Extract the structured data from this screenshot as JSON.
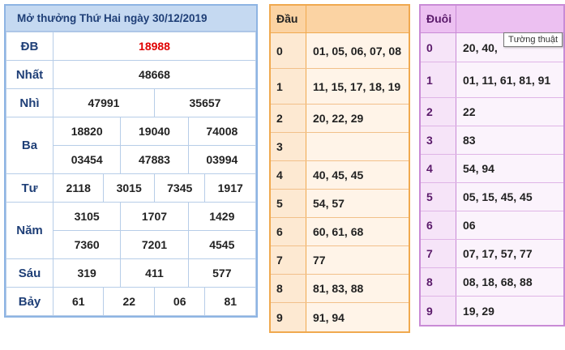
{
  "results": {
    "title": "Mở thưởng Thứ Hai ngày 30/12/2019",
    "db": {
      "label": "ĐB",
      "value": "18988"
    },
    "nhat": {
      "label": "Nhất",
      "value": "48668"
    },
    "nhi": {
      "label": "Nhì",
      "values": [
        "47991",
        "35657"
      ]
    },
    "ba": {
      "label": "Ba",
      "values": [
        "18820",
        "19040",
        "74008",
        "03454",
        "47883",
        "03994"
      ]
    },
    "tu": {
      "label": "Tư",
      "values": [
        "2118",
        "3015",
        "7345",
        "1917"
      ]
    },
    "nam": {
      "label": "Năm",
      "values": [
        "3105",
        "1707",
        "1429",
        "7360",
        "7201",
        "4545"
      ]
    },
    "sau": {
      "label": "Sáu",
      "values": [
        "319",
        "411",
        "577"
      ]
    },
    "bay": {
      "label": "Bảy",
      "values": [
        "61",
        "22",
        "06",
        "81"
      ]
    }
  },
  "dau": {
    "header": "Đầu",
    "rows": [
      {
        "key": "0",
        "value": "01, 05, 06, 07, 08"
      },
      {
        "key": "1",
        "value": "11, 15, 17, 18, 19"
      },
      {
        "key": "2",
        "value": "20, 22, 29"
      },
      {
        "key": "3",
        "value": ""
      },
      {
        "key": "4",
        "value": "40, 45, 45"
      },
      {
        "key": "5",
        "value": "54, 57"
      },
      {
        "key": "6",
        "value": "60, 61, 68"
      },
      {
        "key": "7",
        "value": "77"
      },
      {
        "key": "8",
        "value": "81, 83, 88"
      },
      {
        "key": "9",
        "value": "91, 94"
      }
    ]
  },
  "duoi": {
    "header": "Đuôi",
    "rows": [
      {
        "key": "0",
        "value": "20, 40,"
      },
      {
        "key": "1",
        "value": "01, 11, 61, 81, 91"
      },
      {
        "key": "2",
        "value": "22"
      },
      {
        "key": "3",
        "value": "83"
      },
      {
        "key": "4",
        "value": "54, 94"
      },
      {
        "key": "5",
        "value": "05, 15, 45, 45"
      },
      {
        "key": "6",
        "value": "06"
      },
      {
        "key": "7",
        "value": "07, 17, 57, 77"
      },
      {
        "key": "8",
        "value": "08, 18, 68, 88"
      },
      {
        "key": "9",
        "value": "19, 29"
      }
    ]
  },
  "tooltip": {
    "text": "Tường thuật"
  },
  "colors": {
    "special_prize": "#e00000",
    "results_border": "#8eb4e3",
    "dau_border": "#f0a94f",
    "duoi_border": "#c98bd6"
  }
}
